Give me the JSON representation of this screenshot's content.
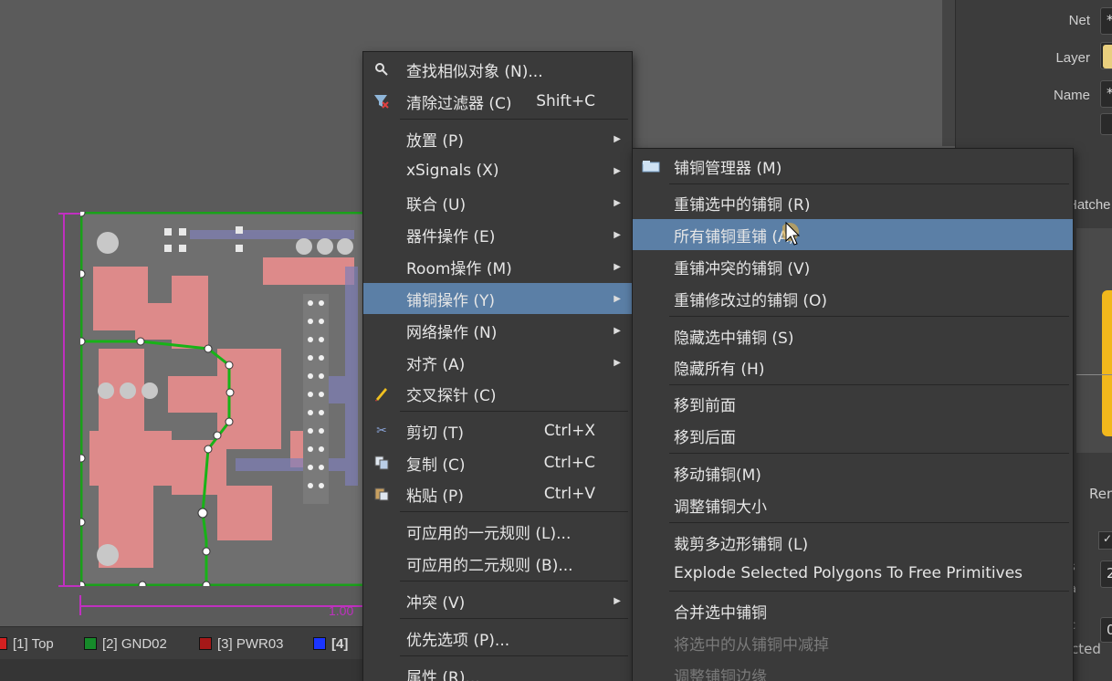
{
  "properties_panel": {
    "net_label": "Net",
    "net_value": "*",
    "layer_label": "Layer",
    "name_label": "Name",
    "name_value": "*",
    "partial_text_hatched": "Hatche",
    "partial_text_rem": "Ren",
    "partial_text_s": "s",
    "partial_text_a": "a",
    "partial_text_2": "2",
    "partial_text_c": "c",
    "partial_text_0": "0",
    "partial_text_cted": "cted"
  },
  "layer_tabs": [
    {
      "label": "[1] Top",
      "color": "#d42020"
    },
    {
      "label": "[2] GND02",
      "color": "#168a2a"
    },
    {
      "label": "[3] PWR03",
      "color": "#a61818"
    },
    {
      "label": "[4]",
      "color": "#1a35ff"
    }
  ],
  "board": {
    "dimension_label": "1.00",
    "colors": {
      "copper": "#e88f8f",
      "outline": "#1aa11a",
      "dim": "#c030c0"
    }
  },
  "main_menu": {
    "items": [
      {
        "icon": "search-icon",
        "label": "查找相似对象 (N)...",
        "shortcut": "",
        "submenu": false
      },
      {
        "icon": "clear-filter-icon",
        "label": "清除过滤器 (C)",
        "shortcut": "Shift+C",
        "submenu": false
      },
      {
        "icon": "",
        "label": "放置 (P)",
        "shortcut": "",
        "submenu": true
      },
      {
        "icon": "",
        "label": "xSignals (X)",
        "shortcut": "",
        "submenu": true
      },
      {
        "icon": "",
        "label": "联合 (U)",
        "shortcut": "",
        "submenu": true
      },
      {
        "icon": "",
        "label": "器件操作 (E)",
        "shortcut": "",
        "submenu": true
      },
      {
        "icon": "",
        "label": "Room操作 (M)",
        "shortcut": "",
        "submenu": true
      },
      {
        "icon": "",
        "label": "铺铜操作 (Y)",
        "shortcut": "",
        "submenu": true
      },
      {
        "icon": "",
        "label": "网络操作 (N)",
        "shortcut": "",
        "submenu": true
      },
      {
        "icon": "",
        "label": "对齐 (A)",
        "shortcut": "",
        "submenu": true
      },
      {
        "icon": "cross-probe-icon",
        "label": "交叉探针 (C)",
        "shortcut": "",
        "submenu": false
      },
      {
        "icon": "cut-icon",
        "label": "剪切 (T)",
        "shortcut": "Ctrl+X",
        "submenu": false
      },
      {
        "icon": "copy-icon",
        "label": "复制 (C)",
        "shortcut": "Ctrl+C",
        "submenu": false
      },
      {
        "icon": "paste-icon",
        "label": "粘贴 (P)",
        "shortcut": "Ctrl+V",
        "submenu": false
      },
      {
        "icon": "",
        "label": "可应用的一元规则 (L)...",
        "shortcut": "",
        "submenu": false
      },
      {
        "icon": "",
        "label": "可应用的二元规则 (B)...",
        "shortcut": "",
        "submenu": false
      },
      {
        "icon": "",
        "label": "冲突 (V)",
        "shortcut": "",
        "submenu": true
      },
      {
        "icon": "",
        "label": "优先选项 (P)...",
        "shortcut": "",
        "submenu": false
      },
      {
        "icon": "",
        "label": "属性 (R)...",
        "shortcut": "",
        "submenu": false
      }
    ],
    "highlighted": "铺铜操作 (Y)"
  },
  "polygon_submenu": {
    "items": [
      {
        "icon": "polygon-manager-icon",
        "label": "铺铜管理器 (M)",
        "enabled": true
      },
      {
        "icon": "",
        "label": "重铺选中的铺铜 (R)",
        "enabled": true
      },
      {
        "icon": "",
        "label": "所有铺铜重铺 (A)",
        "enabled": true
      },
      {
        "icon": "",
        "label": "重铺冲突的铺铜 (V)",
        "enabled": true
      },
      {
        "icon": "",
        "label": "重铺修改过的铺铜 (O)",
        "enabled": true
      },
      {
        "icon": "",
        "label": "隐藏选中铺铜 (S)",
        "enabled": true
      },
      {
        "icon": "",
        "label": "隐藏所有 (H)",
        "enabled": true
      },
      {
        "icon": "",
        "label": "移到前面",
        "enabled": true
      },
      {
        "icon": "",
        "label": "移到后面",
        "enabled": true
      },
      {
        "icon": "",
        "label": "移动铺铜(M)",
        "enabled": true
      },
      {
        "icon": "",
        "label": "调整铺铜大小",
        "enabled": true
      },
      {
        "icon": "",
        "label": "裁剪多边形铺铜 (L)",
        "enabled": true
      },
      {
        "icon": "",
        "label": "Explode Selected Polygons To Free Primitives",
        "enabled": true
      },
      {
        "icon": "",
        "label": "合并选中铺铜",
        "enabled": true
      },
      {
        "icon": "",
        "label": "将选中的从铺铜中减掉",
        "enabled": false
      },
      {
        "icon": "",
        "label": "调整铺铜边缘",
        "enabled": false
      }
    ],
    "highlighted": "所有铺铜重铺 (A)"
  }
}
